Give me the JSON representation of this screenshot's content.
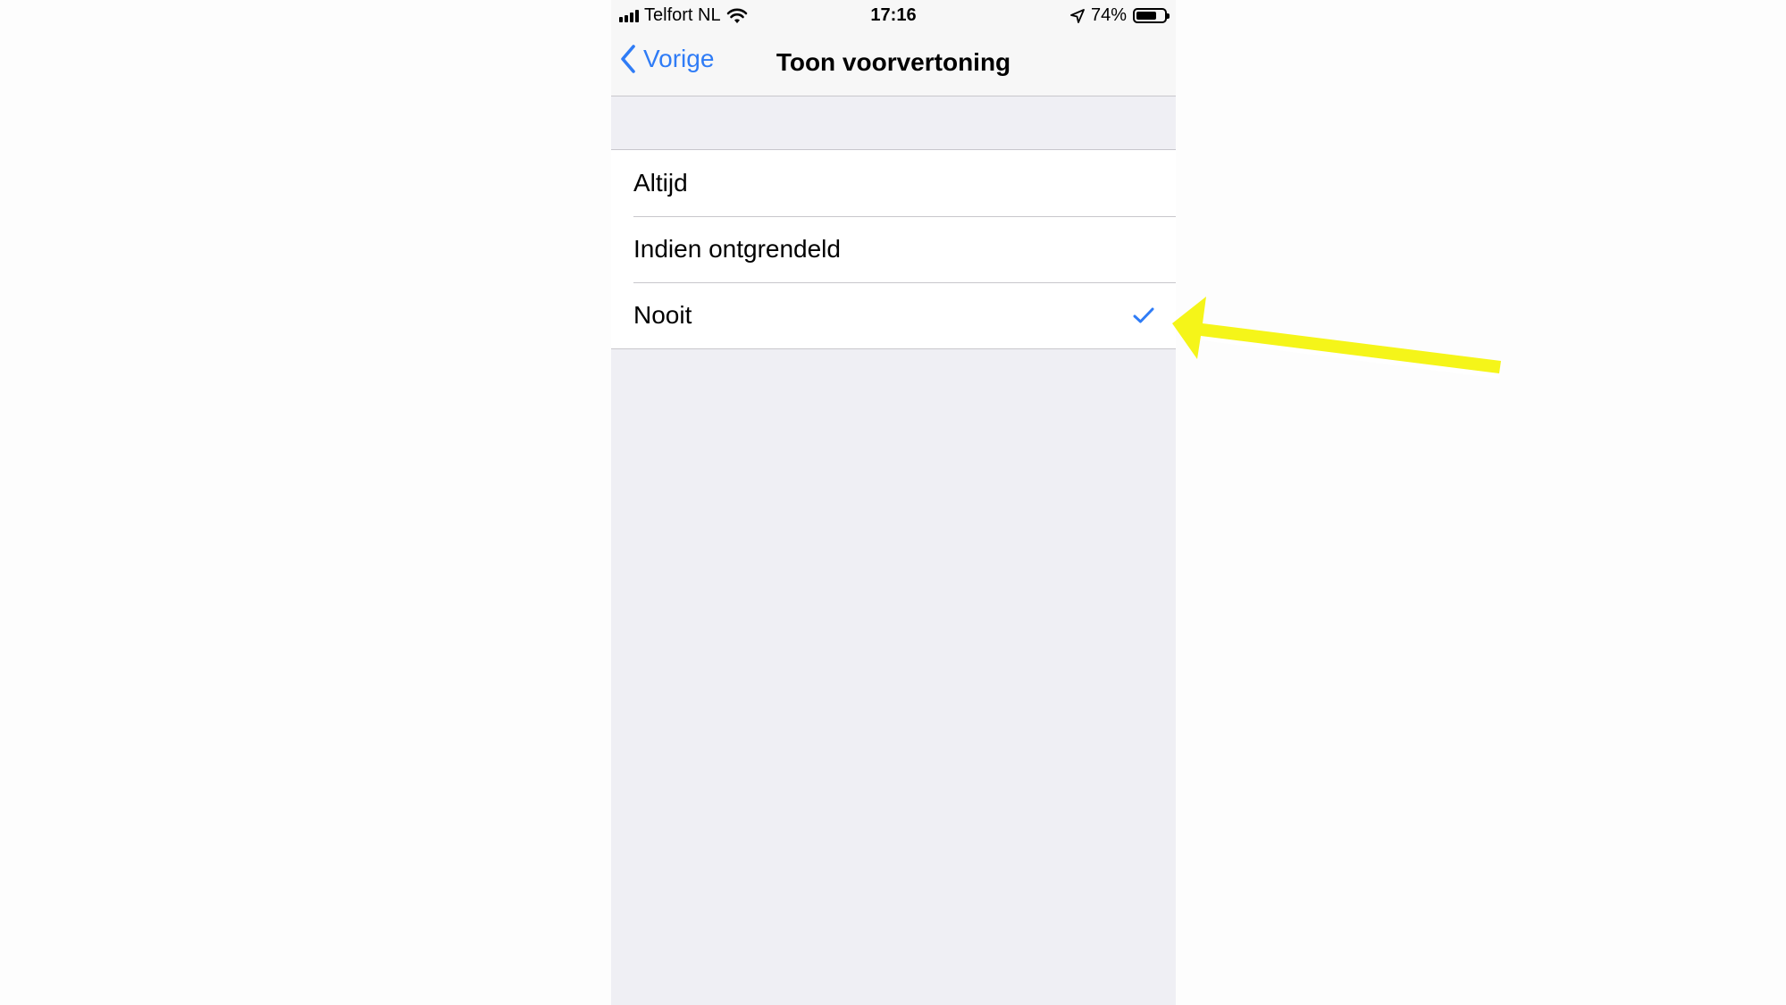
{
  "status_bar": {
    "carrier": "Telfort NL",
    "time": "17:16",
    "battery_percent_text": "74%",
    "battery_level": 0.74,
    "signal_icon": "signal-bars-icon",
    "wifi_icon": "wifi-icon",
    "location_icon": "location-arrow-icon",
    "battery_icon": "battery-icon"
  },
  "nav": {
    "back_label": "Vorige",
    "back_icon": "chevron-left-icon",
    "title": "Toon voorvertoning"
  },
  "options": [
    {
      "label": "Altijd",
      "selected": false
    },
    {
      "label": "Indien ontgrendeld",
      "selected": false
    },
    {
      "label": "Nooit",
      "selected": true
    }
  ],
  "colors": {
    "accent": "#2f7cf6",
    "arrow": "#f5f519",
    "background": "#efeff4",
    "nav_background": "#f7f7f7"
  }
}
